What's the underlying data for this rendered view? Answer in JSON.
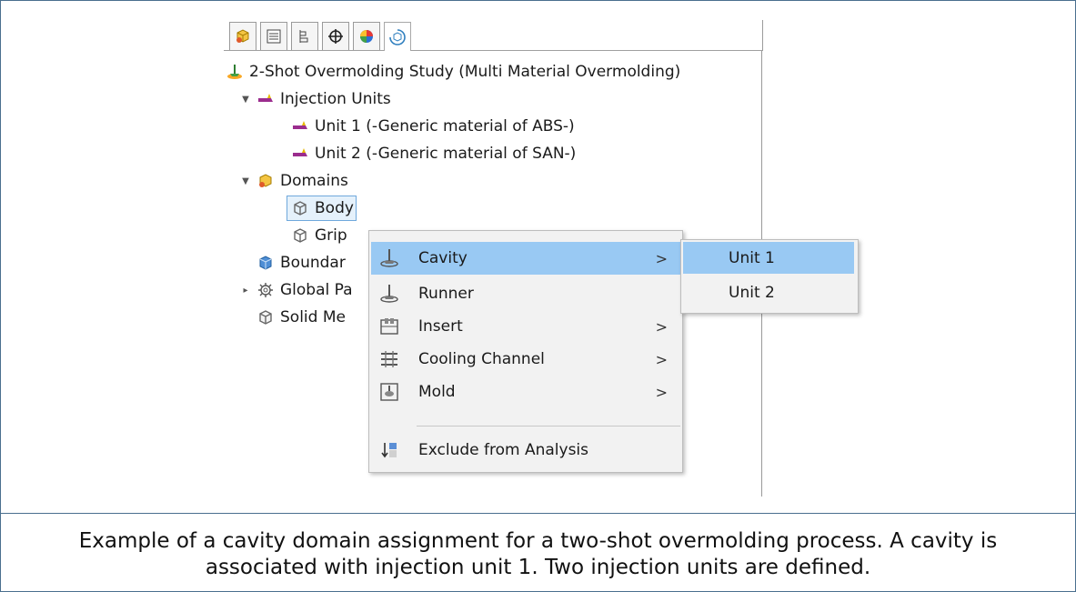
{
  "tree": {
    "study": "2-Shot Overmolding Study (Multi Material Overmolding)",
    "injection_units": "Injection Units",
    "unit1": "Unit 1 (-Generic material of ABS-)",
    "unit2": "Unit 2 (-Generic material of SAN-)",
    "domains": "Domains",
    "body": "Body",
    "grip": "Grip",
    "boundary": "Boundar",
    "global": "Global Pa",
    "solid": "Solid Me"
  },
  "context_menu": {
    "items": [
      {
        "label": "Cavity",
        "icon": "cavity-icon",
        "submenu": true
      },
      {
        "label": "Runner",
        "icon": "runner-icon",
        "submenu": false
      },
      {
        "label": "Insert",
        "icon": "insert-icon",
        "submenu": true
      },
      {
        "label": "Cooling Channel",
        "icon": "cooling-channel-icon",
        "submenu": true
      },
      {
        "label": "Mold",
        "icon": "mold-icon",
        "submenu": true
      },
      {
        "label": "Exclude from Analysis",
        "icon": "exclude-icon",
        "submenu": false
      }
    ],
    "chevron": ">"
  },
  "submenu": {
    "items": [
      "Unit 1",
      "Unit 2"
    ]
  },
  "caption": "Example of a cavity domain assignment for a two-shot overmolding process. A cavity is associated with injection unit 1. Two injection units are defined.",
  "colors": {
    "highlight": "#99c9f3",
    "selection_border": "#6fa8dc",
    "injection_unit": "#9b2d8e",
    "border": "#4a6f8f"
  }
}
